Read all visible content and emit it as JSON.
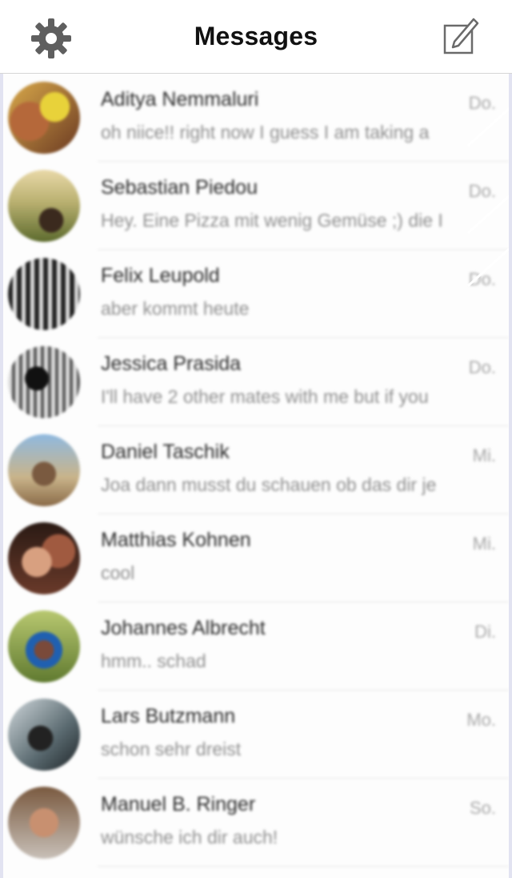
{
  "header": {
    "title": "Messages",
    "settings_icon": "gear-icon",
    "compose_icon": "compose-icon"
  },
  "colors": {
    "title": "#111111",
    "name": "#2a2a2a",
    "preview": "#8f8f8f",
    "date": "#a8a8a8"
  },
  "conversations": [
    {
      "name": "Aditya Nemmaluri",
      "preview": "oh niice!! right now I guess I am taking a",
      "date": "Do."
    },
    {
      "name": "Sebastian Piedou",
      "preview": "Hey. Eine Pizza mit wenig Gemüse ;) die I",
      "date": "Do."
    },
    {
      "name": "Felix Leupold",
      "preview": "aber kommt heute",
      "date": "Do."
    },
    {
      "name": "Jessica Prasida",
      "preview": "I'll have 2 other mates with me but if you",
      "date": "Do."
    },
    {
      "name": "Daniel Taschik",
      "preview": "Joa dann musst du schauen ob das dir je",
      "date": "Mi."
    },
    {
      "name": "Matthias Kohnen",
      "preview": "cool",
      "date": "Mi."
    },
    {
      "name": "Johannes Albrecht",
      "preview": "hmm.. schad",
      "date": "Di."
    },
    {
      "name": "Lars Butzmann",
      "preview": "schon sehr dreist",
      "date": "Mo."
    },
    {
      "name": "Manuel B. Ringer",
      "preview": "wünsche ich dir auch!",
      "date": "So."
    }
  ]
}
